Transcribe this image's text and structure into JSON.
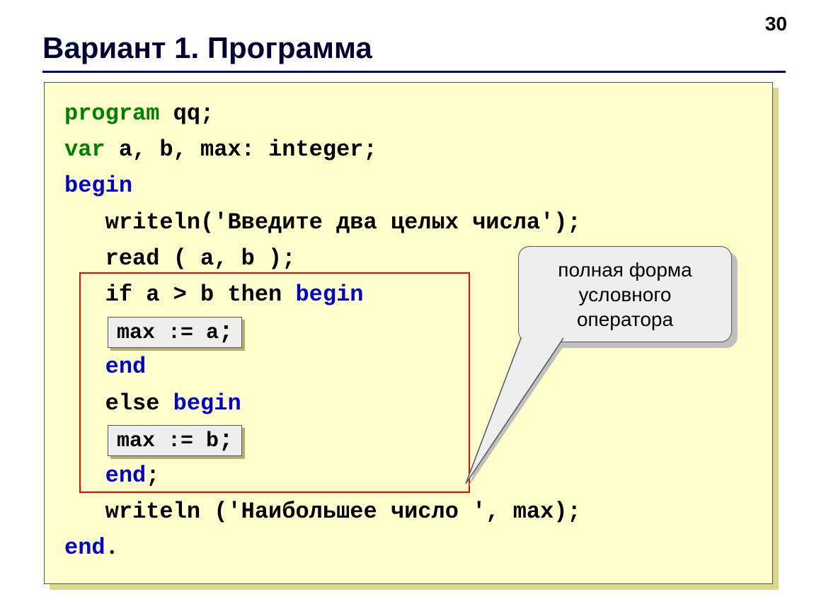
{
  "page_number": "30",
  "title": "Вариант 1. Программа",
  "code": {
    "l1_a": "program",
    "l1_b": " qq;",
    "l2_a": "var",
    "l2_b": " a, b, max: integer;",
    "l3_a": "begin",
    "l4": "   writeln('Введите два целых числа');",
    "l5": "   read ( a, b );",
    "l6_a": "   if a > b then ",
    "l6_b": "begin",
    "l8_a": "   end",
    "l9_a": "   else ",
    "l9_b": "begin",
    "l11_a": "   end",
    "l11_b": ";",
    "l12": "   writeln ('Наибольшее число ', max);",
    "l13_a": "end",
    "l13_b": "."
  },
  "chip1": "max := a",
  "chip1_tail": ";",
  "chip2": "max := b",
  "chip2_tail": ";",
  "callout": "полная форма\nусловного\nоператора"
}
